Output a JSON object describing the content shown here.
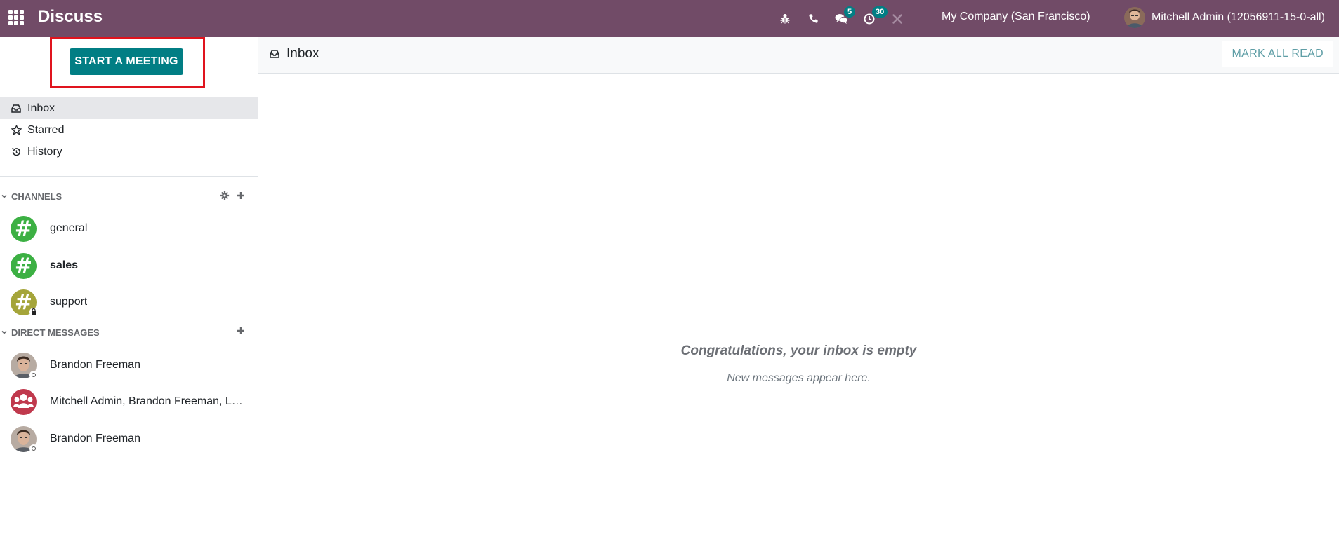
{
  "topbar": {
    "app_title": "Discuss",
    "apps_icon": "grid-icon",
    "icons": [
      "bug-icon",
      "phone-icon",
      "chat-icon",
      "clock-icon",
      "tools-icon"
    ],
    "messages_badge": "5",
    "activities_badge": "30",
    "company": "My Company (San Francisco)",
    "user_name": "Mitchell Admin (12056911-15-0-all)",
    "bg_color": "#714b67"
  },
  "sidebar": {
    "start_meeting_label": "START A MEETING",
    "mailboxes": [
      {
        "label": "Inbox",
        "icon": "inbox-icon",
        "active": true
      },
      {
        "label": "Starred",
        "icon": "star-icon",
        "active": false
      },
      {
        "label": "History",
        "icon": "history-icon",
        "active": false
      }
    ],
    "channels_header": "CHANNELS",
    "channels": [
      {
        "name": "general",
        "color": "#3cb043",
        "bold": false,
        "locked": false
      },
      {
        "name": "sales",
        "color": "#3cb043",
        "bold": true,
        "locked": false
      },
      {
        "name": "support",
        "color": "#a5a53a",
        "bold": false,
        "locked": true
      }
    ],
    "dm_header": "DIRECT MESSAGES",
    "direct_messages": [
      {
        "name": "Brandon Freeman",
        "type": "person"
      },
      {
        "name": "Mitchell Admin, Brandon Freeman, La...",
        "type": "group"
      },
      {
        "name": "Brandon Freeman",
        "type": "person"
      }
    ]
  },
  "main": {
    "title": "Inbox",
    "mark_all_read_label": "MARK ALL READ",
    "empty_title": "Congratulations, your inbox is empty",
    "empty_subtitle": "New messages appear here."
  },
  "colors": {
    "accent": "#017e84",
    "highlight": "#e0141e"
  }
}
